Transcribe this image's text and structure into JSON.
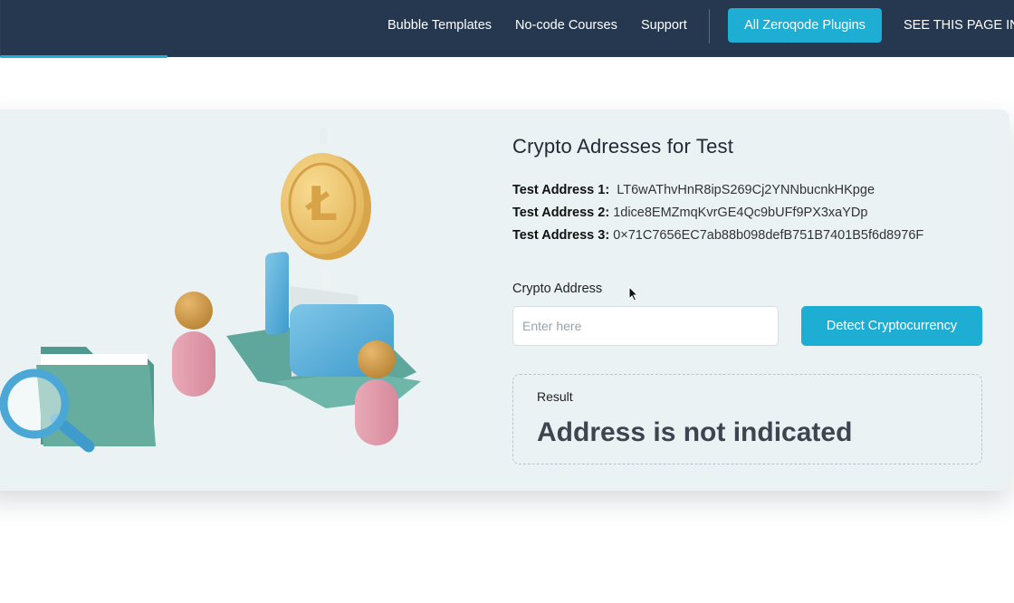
{
  "nav": {
    "links": [
      "Bubble Templates",
      "No-code Courses",
      "Support"
    ],
    "plugins_button": "All Zeroqode Plugins",
    "see_page": "SEE THIS PAGE IN"
  },
  "card": {
    "title": "Crypto Adresses for Test",
    "addresses": [
      {
        "label": "Test Address 1:",
        "value": "LT6wAThvHnR8ipS269Cj2YNNbucnkHKpge"
      },
      {
        "label": "Test Address 2:",
        "value": "1dice8EMZmqKvrGE4Qc9bUFf9PX3xaYDp"
      },
      {
        "label": "Test Address 3:",
        "value": "0×71C7656EC7ab88b098defB751B7401B5f6d8976F"
      }
    ],
    "input_label": "Crypto Address",
    "input_placeholder": "Enter here",
    "input_value": "",
    "detect_button": "Detect Cryptocurrency",
    "result_label": "Result",
    "result_text": "Address is not indicated"
  },
  "colors": {
    "navbar": "#263850",
    "accent": "#1faed3",
    "card_bg": "#eaf2f4"
  }
}
